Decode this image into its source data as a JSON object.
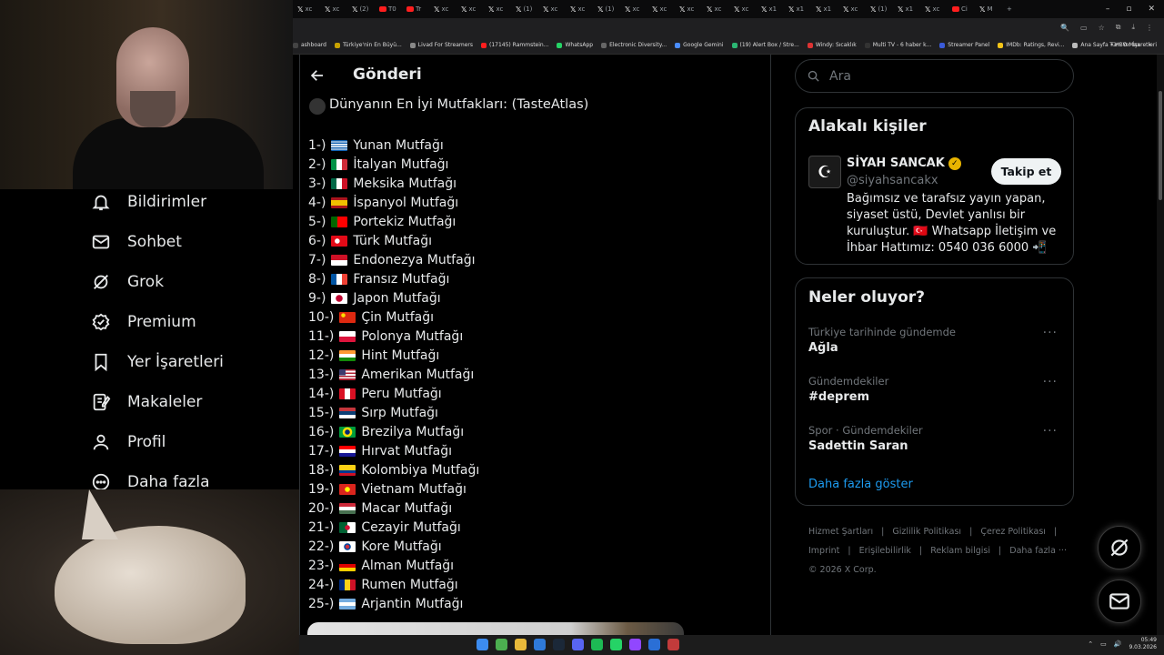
{
  "browser": {
    "tabs": [
      {
        "label": "xc",
        "kind": "x"
      },
      {
        "label": "xc",
        "kind": "x"
      },
      {
        "label": "(2)",
        "kind": "x"
      },
      {
        "label": "T0",
        "kind": "yt"
      },
      {
        "label": "Tr",
        "kind": "yt"
      },
      {
        "label": "xc",
        "kind": "x"
      },
      {
        "label": "xc",
        "kind": "x"
      },
      {
        "label": "xc",
        "kind": "x"
      },
      {
        "label": "(1)",
        "kind": "x"
      },
      {
        "label": "xc",
        "kind": "x"
      },
      {
        "label": "xc",
        "kind": "x"
      },
      {
        "label": "(1)",
        "kind": "x"
      },
      {
        "label": "xc",
        "kind": "x"
      },
      {
        "label": "xc",
        "kind": "x"
      },
      {
        "label": "xc",
        "kind": "x"
      },
      {
        "label": "xc",
        "kind": "x"
      },
      {
        "label": "xc",
        "kind": "x"
      },
      {
        "label": "x1",
        "kind": "x"
      },
      {
        "label": "x1",
        "kind": "x"
      },
      {
        "label": "x1",
        "kind": "x"
      },
      {
        "label": "xc",
        "kind": "x"
      },
      {
        "label": "(1)",
        "kind": "x"
      },
      {
        "label": "x1",
        "kind": "x"
      },
      {
        "label": "xc",
        "kind": "x"
      },
      {
        "label": "Ci",
        "kind": "yt"
      },
      {
        "label": "M",
        "kind": "x"
      }
    ],
    "new_tab": "+",
    "bookmarks": [
      {
        "label": "ashboard",
        "color": "#444"
      },
      {
        "label": "Türkiye'nin En Büyü...",
        "color": "#c7a100"
      },
      {
        "label": "Livad For Streamers",
        "color": "#888"
      },
      {
        "label": "(17145) Rammstein...",
        "color": "#ff1e1e"
      },
      {
        "label": "WhatsApp",
        "color": "#25d366"
      },
      {
        "label": "Electronic Diversity...",
        "color": "#666"
      },
      {
        "label": "Google Gemini",
        "color": "#4a8cff"
      },
      {
        "label": "(19) Alert Box / Stre...",
        "color": "#2bb673"
      },
      {
        "label": "Windy: Sıcaklık",
        "color": "#d33"
      },
      {
        "label": "Multi TV - 6 haber k...",
        "color": "#333"
      },
      {
        "label": "Streamer Panel",
        "color": "#3a5bd9"
      },
      {
        "label": "IMDb: Ratings, Revi...",
        "color": "#f5c518"
      },
      {
        "label": "Ana Sayfa • HBO Max",
        "color": "#bbb"
      }
    ],
    "bookmarks_more": "»",
    "all_bookmarks": "Tüm Yer İşaretleri"
  },
  "leftnav": {
    "items": [
      {
        "label": "Bildirimler",
        "icon": "bell-icon"
      },
      {
        "label": "Sohbet",
        "icon": "envelope-icon"
      },
      {
        "label": "Grok",
        "icon": "grok-icon"
      },
      {
        "label": "Premium",
        "icon": "verified-icon"
      },
      {
        "label": "Yer İşaretleri",
        "icon": "bookmark-icon"
      },
      {
        "label": "Makaleler",
        "icon": "article-icon"
      },
      {
        "label": "Profil",
        "icon": "person-icon"
      },
      {
        "label": "Daha fazla",
        "icon": "more-icon"
      }
    ]
  },
  "post": {
    "header": "Gönderi",
    "heading": "Dünyanın En İyi Mutfakları: (TasteAtlas)",
    "items": [
      {
        "num": "1-)",
        "name": "Yunan Mutfağı",
        "flag": "greece"
      },
      {
        "num": "2-)",
        "name": "İtalyan Mutfağı",
        "flag": "italy"
      },
      {
        "num": "3-)",
        "name": "Meksika Mutfağı",
        "flag": "mexico"
      },
      {
        "num": "4-)",
        "name": "İspanyol Mutfağı",
        "flag": "spain"
      },
      {
        "num": "5-)",
        "name": "Portekiz Mutfağı",
        "flag": "portugal"
      },
      {
        "num": "6-)",
        "name": "Türk Mutfağı",
        "flag": "turkey"
      },
      {
        "num": "7-)",
        "name": "Endonezya Mutfağı",
        "flag": "indonesia"
      },
      {
        "num": "8-)",
        "name": "Fransız Mutfağı",
        "flag": "france"
      },
      {
        "num": "9-)",
        "name": "Japon Mutfağı",
        "flag": "japan"
      },
      {
        "num": "10-)",
        "name": "Çin Mutfağı",
        "flag": "china"
      },
      {
        "num": "11-)",
        "name": "Polonya Mutfağı",
        "flag": "poland"
      },
      {
        "num": "12-)",
        "name": "Hint Mutfağı",
        "flag": "india"
      },
      {
        "num": "13-)",
        "name": "Amerikan Mutfağı",
        "flag": "usa"
      },
      {
        "num": "14-)",
        "name": "Peru Mutfağı",
        "flag": "peru"
      },
      {
        "num": "15-)",
        "name": "Sırp Mutfağı",
        "flag": "serbia"
      },
      {
        "num": "16-)",
        "name": "Brezilya Mutfağı",
        "flag": "brazil"
      },
      {
        "num": "17-)",
        "name": "Hırvat Mutfağı",
        "flag": "croatia"
      },
      {
        "num": "18-)",
        "name": "Kolombiya Mutfağı",
        "flag": "colombia"
      },
      {
        "num": "19-)",
        "name": "Vietnam Mutfağı",
        "flag": "vietnam"
      },
      {
        "num": "20-)",
        "name": "Macar Mutfağı",
        "flag": "hungary"
      },
      {
        "num": "21-)",
        "name": "Cezayir Mutfağı",
        "flag": "algeria"
      },
      {
        "num": "22-)",
        "name": "Kore Mutfağı",
        "flag": "korea"
      },
      {
        "num": "23-)",
        "name": "Alman Mutfağı",
        "flag": "germany"
      },
      {
        "num": "24-)",
        "name": "Rumen Mutfağı",
        "flag": "romania"
      },
      {
        "num": "25-)",
        "name": "Arjantin Mutfağı",
        "flag": "argentina"
      }
    ]
  },
  "sidebar": {
    "search_placeholder": "Ara",
    "related": {
      "title": "Alakalı kişiler",
      "name": "SİYAH SANCAK",
      "handle": "@siyahsancakx",
      "bio": "Bağımsız ve tarafsız yayın yapan, siyaset üstü, Devlet yanlısı bir kuruluştur. 🇹🇷 Whatsapp İletişim ve İhbar Hattımız: 0540 036 6000 📲",
      "follow_label": "Takip et"
    },
    "trends": {
      "title": "Neler oluyor?",
      "items": [
        {
          "context": "Türkiye tarihinde gündemde",
          "title": "Ağla"
        },
        {
          "context": "Gündemdekiler",
          "title": "#deprem"
        },
        {
          "context": "Spor · Gündemdekiler",
          "title": "Sadettin Saran"
        }
      ],
      "more_icon": "···",
      "show_more": "Daha fazla göster"
    },
    "footer": {
      "links": [
        "Hizmet Şartları",
        "|",
        "Gizlilik Politikası",
        "|",
        "Çerez Politikası",
        "|",
        "Imprint",
        "|",
        "Erişilebilirlik",
        "|",
        "Reklam bilgisi",
        "|",
        "Daha fazla ···"
      ],
      "copyright": "© 2026 X Corp."
    }
  },
  "taskbar": {
    "time": "05:49",
    "date": "9.03.2026"
  },
  "colors": {
    "accent": "#1d9bf0",
    "background": "#000000",
    "border": "#2f3336",
    "muted": "#71767b"
  }
}
